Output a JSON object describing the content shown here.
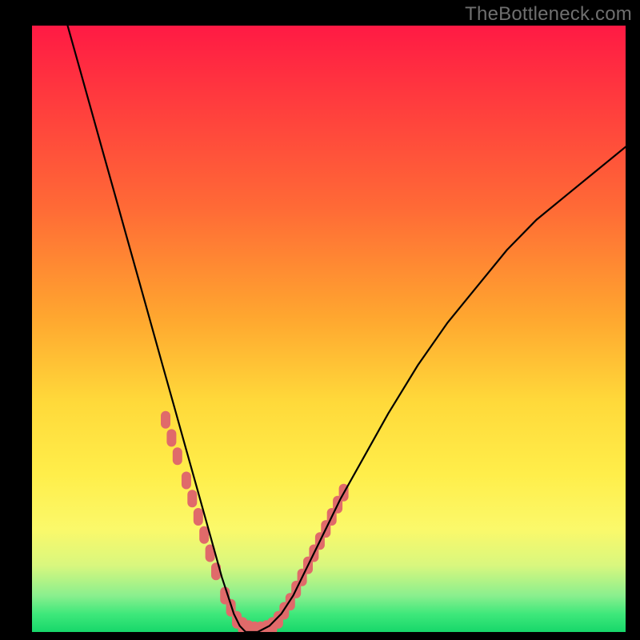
{
  "watermark": {
    "text": "TheBottleneck.com"
  },
  "colors": {
    "frame_bg": "#000000",
    "curve_stroke": "#000000",
    "marker_fill": "#e06a6a",
    "gradient_top": "#ff1a44",
    "gradient_bottom": "#17d76a"
  },
  "chart_data": {
    "type": "line",
    "title": "",
    "xlabel": "",
    "ylabel": "",
    "xlim": [
      0,
      100
    ],
    "ylim": [
      0,
      100
    ],
    "grid": false,
    "legend": false,
    "notes": "Values estimated from pixel positions; y is bottleneck % (0 at bottom, 100 at top).",
    "series": [
      {
        "name": "bottleneck-curve",
        "x": [
          6,
          8,
          10,
          12,
          14,
          16,
          18,
          20,
          22,
          24,
          26,
          28,
          30,
          32,
          33,
          34,
          35,
          36,
          37,
          38,
          40,
          42,
          44,
          46,
          48,
          50,
          52,
          56,
          60,
          65,
          70,
          75,
          80,
          85,
          90,
          95,
          100
        ],
        "y": [
          100,
          93,
          86,
          79,
          72,
          65,
          58,
          51,
          44,
          37,
          30,
          23,
          16,
          9,
          6,
          3,
          1,
          0,
          0,
          0,
          1,
          3,
          6,
          10,
          14,
          18,
          22,
          29,
          36,
          44,
          51,
          57,
          63,
          68,
          72,
          76,
          80
        ]
      }
    ],
    "markers": {
      "name": "highlight-dots",
      "x": [
        22.5,
        23.5,
        24.5,
        26.0,
        27.0,
        28.0,
        29.0,
        30.0,
        31.0,
        32.5,
        33.5,
        34.5,
        35.5,
        36.5,
        37.5,
        38.5,
        39.5,
        40.5,
        41.5,
        42.5,
        43.5,
        44.5,
        45.5,
        46.5,
        47.5,
        48.5,
        49.5,
        50.5,
        51.5,
        52.5
      ],
      "y": [
        35,
        32,
        29,
        25,
        22,
        19,
        16,
        13,
        10,
        6,
        4,
        2,
        1,
        0.5,
        0.3,
        0.3,
        0.5,
        1,
        2,
        3.5,
        5,
        7,
        9,
        11,
        13,
        15,
        17,
        19,
        21,
        23
      ]
    }
  }
}
